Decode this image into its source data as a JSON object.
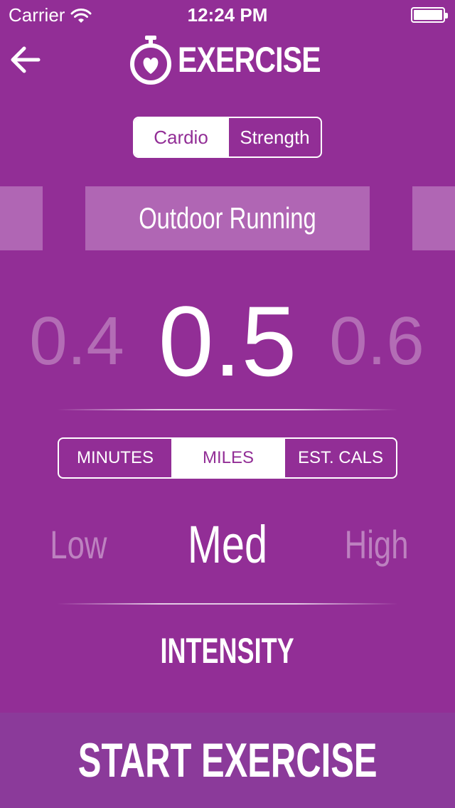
{
  "status_bar": {
    "carrier": "Carrier",
    "time": "12:24 PM"
  },
  "header": {
    "title": "EXERCISE"
  },
  "exercise_type": {
    "options": [
      "Cardio",
      "Strength"
    ],
    "selected": "Cardio"
  },
  "activity": {
    "current": "Outdoor Running"
  },
  "value_picker": {
    "previous": "0.4",
    "current": "0.5",
    "next": "0.6"
  },
  "unit": {
    "options": [
      "MINUTES",
      "MILES",
      "EST. CALS"
    ],
    "selected": "MILES"
  },
  "intensity": {
    "options": [
      "Low",
      "Med",
      "High"
    ],
    "selected": "Med",
    "label": "INTENSITY"
  },
  "start_button": {
    "label": "START EXERCISE"
  },
  "colors": {
    "background": "#922e96",
    "tile": "#b066b4",
    "start_bar": "#8b3a9a",
    "text": "#ffffff"
  },
  "icons": [
    "wifi-icon",
    "battery-icon",
    "back-arrow-icon",
    "stopwatch-heart-icon"
  ]
}
